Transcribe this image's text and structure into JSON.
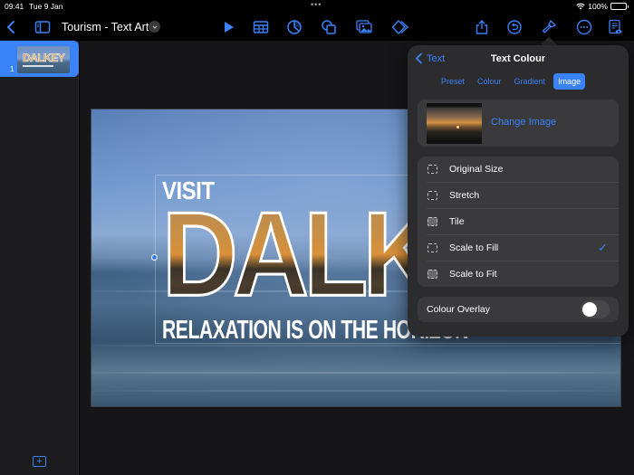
{
  "status_bar": {
    "time": "09:41",
    "date": "Tue 9 Jan",
    "battery_percent": "100%",
    "battery_level": 1.0
  },
  "toolbar": {
    "back_icon": "chevron-left-icon",
    "sidebar_icon": "sidebar-toggle-icon",
    "document_title": "Tourism - Text Art",
    "title_menu_icon": "chevron-down-icon",
    "center_icons": [
      "play-icon",
      "table-icon",
      "chart-icon",
      "shapes-icon",
      "media-icon",
      "layers-icon"
    ],
    "right_icons": [
      "share-icon",
      "undo-icon",
      "format-paintbrush-icon",
      "more-icon",
      "presenter-notes-icon"
    ],
    "accent_color": "#3a82f7"
  },
  "sidebar": {
    "slides": [
      {
        "number": "1",
        "thumbnail_text": "DALKEY",
        "selected": true
      }
    ],
    "add_slide_icon": "plus-icon"
  },
  "slide": {
    "visit_text": "VISIT",
    "title_text": "DALKEY",
    "tagline_text": "RELAXATION IS ON THE HORIZON"
  },
  "popover": {
    "back_label": "Text",
    "title": "Text Colour",
    "tabs": [
      {
        "label": "Preset",
        "active": false
      },
      {
        "label": "Colour",
        "active": false
      },
      {
        "label": "Gradient",
        "active": false
      },
      {
        "label": "Image",
        "active": true
      }
    ],
    "change_image_label": "Change Image",
    "scale_options": [
      {
        "label": "Original Size",
        "selected": false
      },
      {
        "label": "Stretch",
        "selected": false
      },
      {
        "label": "Tile",
        "selected": false
      },
      {
        "label": "Scale to Fill",
        "selected": true
      },
      {
        "label": "Scale to Fit",
        "selected": false
      }
    ],
    "check_mark": "✓",
    "colour_overlay_label": "Colour Overlay",
    "colour_overlay_on": false
  }
}
